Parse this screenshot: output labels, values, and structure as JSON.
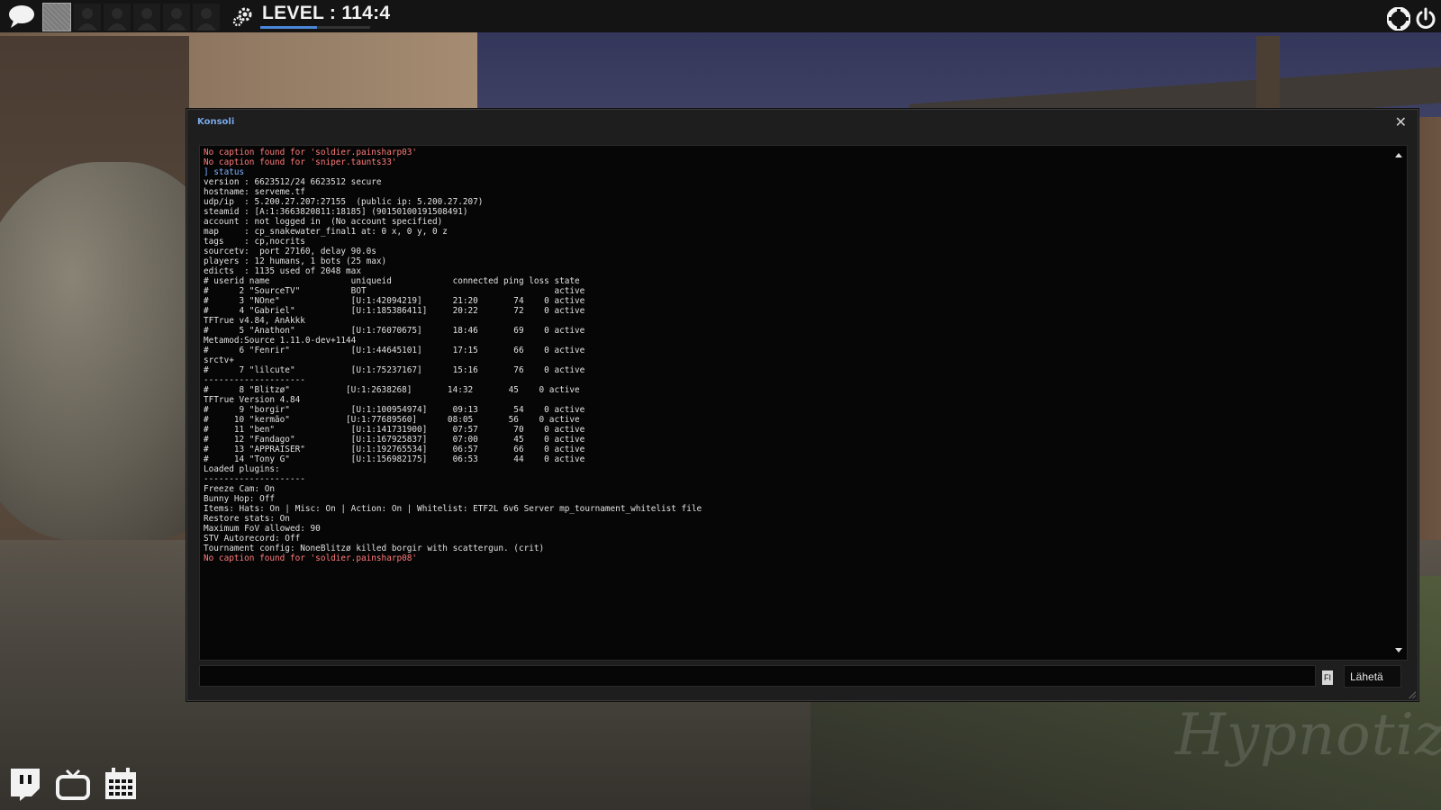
{
  "topbar": {
    "level_text": "LEVEL : 114:4",
    "level_progress": 0.52
  },
  "console": {
    "title": "Konsoli",
    "close_glyph": "✕",
    "lines": [
      {
        "text": "No caption found for 'soldier.painsharp03'",
        "kind": "err"
      },
      {
        "text": "No caption found for 'sniper.taunts33'",
        "kind": "err"
      },
      {
        "text": "] status",
        "kind": "cmd"
      },
      {
        "text": "version : 6623512/24 6623512 secure",
        "kind": "out"
      },
      {
        "text": "hostname: serveme.tf",
        "kind": "out"
      },
      {
        "text": "udp/ip  : 5.200.27.207:27155  (public ip: 5.200.27.207)",
        "kind": "out"
      },
      {
        "text": "steamid : [A:1:3663820811:18185] (90150100191508491)",
        "kind": "out"
      },
      {
        "text": "account : not logged in  (No account specified)",
        "kind": "out"
      },
      {
        "text": "map     : cp_snakewater_final1 at: 0 x, 0 y, 0 z",
        "kind": "out"
      },
      {
        "text": "tags    : cp,nocrits",
        "kind": "out"
      },
      {
        "text": "sourcetv:  port 27160, delay 90.0s",
        "kind": "out"
      },
      {
        "text": "players : 12 humans, 1 bots (25 max)",
        "kind": "out"
      },
      {
        "text": "edicts  : 1135 used of 2048 max",
        "kind": "out"
      },
      {
        "text": "# userid name                uniqueid            connected ping loss state",
        "kind": "out"
      },
      {
        "text": "#      2 \"SourceTV\"          BOT                                     active",
        "kind": "out"
      },
      {
        "text": "#      3 \"NOne\"              [U:1:42094219]      21:20       74    0 active",
        "kind": "out"
      },
      {
        "text": "#      4 \"Gabriel\"           [U:1:185386411]     20:22       72    0 active",
        "kind": "out"
      },
      {
        "text": "TFTrue v4.84, AnAkkk",
        "kind": "out"
      },
      {
        "text": "#      5 \"Anathon\"           [U:1:76070675]      18:46       69    0 active",
        "kind": "out"
      },
      {
        "text": "Metamod:Source 1.11.0-dev+1144",
        "kind": "out"
      },
      {
        "text": "#      6 \"Fenrir\"            [U:1:44645101]      17:15       66    0 active",
        "kind": "out"
      },
      {
        "text": "srctv+",
        "kind": "out"
      },
      {
        "text": "#      7 \"lilcute\"           [U:1:75237167]      15:16       76    0 active",
        "kind": "out"
      },
      {
        "text": "--------------------",
        "kind": "out"
      },
      {
        "text": "#      8 \"Blitzø\"           [U:1:2638268]       14:32       45    0 active",
        "kind": "out"
      },
      {
        "text": "TFTrue Version 4.84",
        "kind": "out"
      },
      {
        "text": "#      9 \"borgir\"            [U:1:100954974]     09:13       54    0 active",
        "kind": "out"
      },
      {
        "text": "#     10 \"kermão\"           [U:1:77689560]      08:05       56    0 active",
        "kind": "out"
      },
      {
        "text": "#     11 \"ben\"               [U:1:141731900]     07:57       70    0 active",
        "kind": "out"
      },
      {
        "text": "#     12 \"Fandago\"           [U:1:167925837]     07:00       45    0 active",
        "kind": "out"
      },
      {
        "text": "#     13 \"APPRAISER\"         [U:1:192765534]     06:57       66    0 active",
        "kind": "out"
      },
      {
        "text": "#     14 \"Tony G\"            [U:1:156982175]     06:53       44    0 active",
        "kind": "out"
      },
      {
        "text": "Loaded plugins:",
        "kind": "out"
      },
      {
        "text": "--------------------",
        "kind": "out"
      },
      {
        "text": "Freeze Cam: On",
        "kind": "out"
      },
      {
        "text": "Bunny Hop: Off",
        "kind": "out"
      },
      {
        "text": "Items: Hats: On | Misc: On | Action: On | Whitelist: ETF2L 6v6 Server mp_tournament_whitelist file",
        "kind": "out"
      },
      {
        "text": "Restore stats: On",
        "kind": "out"
      },
      {
        "text": "Maximum FoV allowed: 90",
        "kind": "out"
      },
      {
        "text": "STV Autorecord: Off",
        "kind": "out"
      },
      {
        "text": "Tournament config: NoneBlitzø killed borgir with scattergun. (crit)",
        "kind": "out"
      },
      {
        "text": "No caption found for 'soldier.painsharp08'",
        "kind": "err"
      }
    ],
    "input_value": "",
    "lang_badge": "FI",
    "send_label": "Lähetä"
  },
  "watermark": "Hypnotize",
  "colors": {
    "error_text": "#ff7a7a",
    "command_text": "#7fb0ff",
    "output_text": "#e0e0e0",
    "title_text": "#78a8e8",
    "level_bar": "#4a86d9"
  },
  "icons": {
    "topbar_left": [
      "chat-bubble-icon",
      "gear-icon"
    ],
    "topbar_right": [
      "lifebuoy-icon",
      "power-icon"
    ],
    "bottom_left": [
      "twitch-icon",
      "tv-icon",
      "calendar-icon"
    ]
  }
}
